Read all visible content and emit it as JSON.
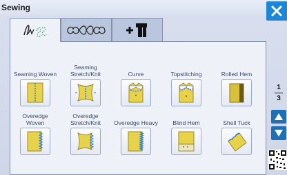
{
  "window": {
    "title": "Sewing"
  },
  "tabs": [
    {
      "name": "utility-stitches",
      "icon": "utility-stitch-icon"
    },
    {
      "name": "decorative-stitches",
      "icon": "decorative-stitch-icon"
    },
    {
      "name": "presser-foot",
      "icon": "plus-foot-icon"
    }
  ],
  "stitches": [
    {
      "label": "Seaming Woven",
      "icon": "seaming-woven-icon"
    },
    {
      "label": "Seaming Stretch/Knit",
      "icon": "seaming-stretch-icon"
    },
    {
      "label": "Curve",
      "icon": "curve-shirt-icon"
    },
    {
      "label": "Topstitching",
      "icon": "topstitching-shirt-icon"
    },
    {
      "label": "Rolled Hem",
      "icon": "rolled-hem-icon"
    },
    {
      "label": "Overedge Woven",
      "icon": "overedge-woven-icon"
    },
    {
      "label": "Overedge Stretch/Knit",
      "icon": "overedge-stretch-icon"
    },
    {
      "label": "Overedge Heavy",
      "icon": "overedge-heavy-icon"
    },
    {
      "label": "Blind Hem",
      "icon": "blind-hem-icon"
    },
    {
      "label": "Shell Tuck",
      "icon": "shell-tuck-icon"
    }
  ],
  "pager": {
    "current": "1",
    "total": "3"
  },
  "colors": {
    "accent": "#1e86d6",
    "fabric": "#e8d24a"
  }
}
